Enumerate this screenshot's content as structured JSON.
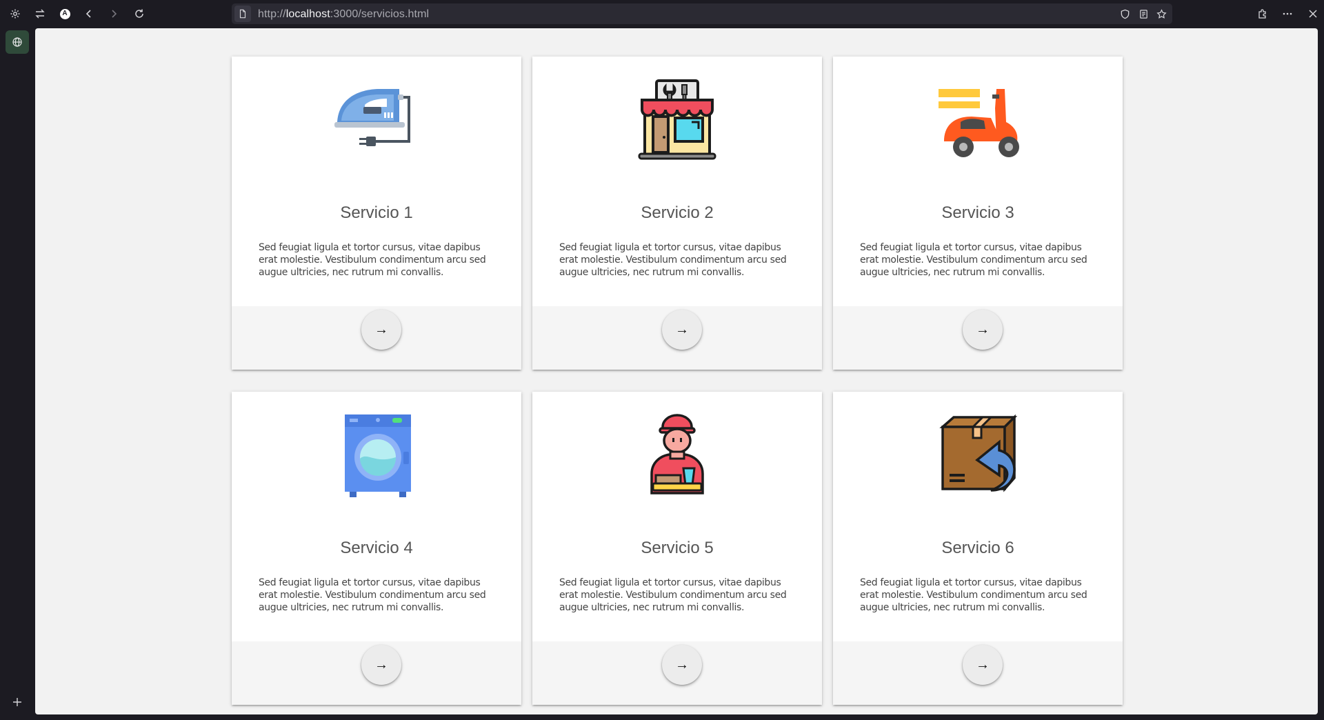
{
  "browser": {
    "url_scheme": "http://",
    "url_host": "localhost",
    "url_path": ":3000/servicios.html",
    "account_initial": "A"
  },
  "cards": [
    {
      "title": "Servicio 1",
      "text": "Sed feugiat ligula et tortor cursus, vitae dapibus erat molestie. Vestibulum condimentum arcu sed augue ultricies, nec rutrum mi convallis.",
      "icon": "iron-icon",
      "action": "→"
    },
    {
      "title": "Servicio 2",
      "text": "Sed feugiat ligula et tortor cursus, vitae dapibus erat molestie. Vestibulum condimentum arcu sed augue ultricies, nec rutrum mi convallis.",
      "icon": "repair-shop-icon",
      "action": "→"
    },
    {
      "title": "Servicio 3",
      "text": "Sed feugiat ligula et tortor cursus, vitae dapibus erat molestie. Vestibulum condimentum arcu sed augue ultricies, nec rutrum mi convallis.",
      "icon": "delivery-scooter-icon",
      "action": "→"
    },
    {
      "title": "Servicio 4",
      "text": "Sed feugiat ligula et tortor cursus, vitae dapibus erat molestie. Vestibulum condimentum arcu sed augue ultricies, nec rutrum mi convallis.",
      "icon": "washing-machine-icon",
      "action": "→"
    },
    {
      "title": "Servicio 5",
      "text": "Sed feugiat ligula et tortor cursus, vitae dapibus erat molestie. Vestibulum condimentum arcu sed augue ultricies, nec rutrum mi convallis.",
      "icon": "delivery-person-icon",
      "action": "→"
    },
    {
      "title": "Servicio 6",
      "text": "Sed feugiat ligula et tortor cursus, vitae dapibus erat molestie. Vestibulum condimentum arcu sed augue ultricies, nec rutrum mi convallis.",
      "icon": "return-box-icon",
      "action": "→"
    }
  ],
  "colors": {
    "page_bg": "#f2f2f2",
    "card_bg": "#ffffff",
    "card_footer_bg": "#f5f5f5",
    "chrome_bg": "#1c1b22"
  }
}
